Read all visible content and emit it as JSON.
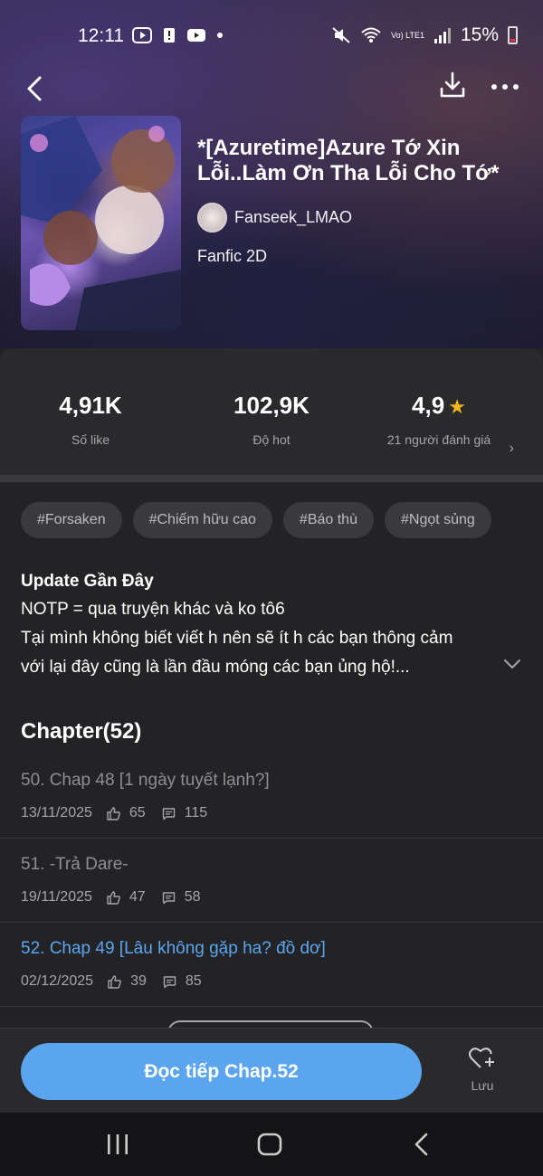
{
  "status_bar": {
    "time": "12:11",
    "network_label": "Vo) LTE1",
    "battery": "15%"
  },
  "book": {
    "title": "*[Azuretime]Azure Tớ Xin Lỗi..Làm Ơn Tha Lỗi Cho Tớ*",
    "author": "Fanseek_LMAO",
    "genre": "Fanfic 2D"
  },
  "stats": {
    "likes_value": "4,91K",
    "likes_label": "Số like",
    "hot_value": "102,9K",
    "hot_label": "Độ hot",
    "rating_value": "4,9",
    "rating_label": "21 người đánh giá"
  },
  "tags": [
    "#Forsaken",
    "#Chiếm hữu cao",
    "#Báo thù",
    "#Ngọt sủng"
  ],
  "update": {
    "title": "Update Gần Đây",
    "line1": "NOTP = qua truyện khác và ko tô6",
    "line2": "Tại mình không biết viết h nên sẽ ít h các bạn thông cảm",
    "line3": "với lại đây cũng là lần đầu móng các bạn ủng hộ!..."
  },
  "chapters_header": "Chapter(52)",
  "chapters": [
    {
      "title": "50. Chap 48 [1 ngày tuyết lạnh?]",
      "date": "13/11/2025",
      "likes": "65",
      "comments": "115"
    },
    {
      "title": "51. -Trả Dare-",
      "date": "19/11/2025",
      "likes": "47",
      "comments": "58"
    },
    {
      "title": "52. Chap 49 [Lâu không gặp ha? đồ dơ]",
      "date": "02/12/2025",
      "likes": "39",
      "comments": "85"
    }
  ],
  "actions": {
    "read_label": "Đọc tiếp Chap.52",
    "save_label": "Lưu"
  },
  "colors": {
    "accent": "#5aa5ee",
    "star": "#f6b51f",
    "background": "#232325"
  }
}
